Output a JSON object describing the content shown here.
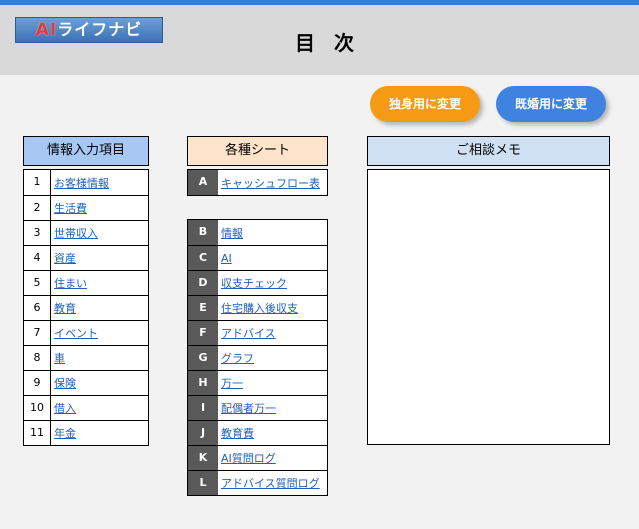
{
  "header": {
    "logo_ai": "AI",
    "logo_rest": "ライフナビ",
    "title": "目 次"
  },
  "buttons": {
    "single": "独身用に変更",
    "married": "既婚用に変更"
  },
  "columns": {
    "info": "情報入力項目",
    "sheets": "各種シート",
    "memo": "ご相談メモ"
  },
  "info_items": [
    {
      "num": "1",
      "label": "お客様情報"
    },
    {
      "num": "2",
      "label": "生活費"
    },
    {
      "num": "3",
      "label": "世帯収入"
    },
    {
      "num": "4",
      "label": "資産"
    },
    {
      "num": "5",
      "label": "住まい"
    },
    {
      "num": "6",
      "label": "教育"
    },
    {
      "num": "7",
      "label": "イベント"
    },
    {
      "num": "8",
      "label": "車"
    },
    {
      "num": "9",
      "label": "保険"
    },
    {
      "num": "10",
      "label": "借入"
    },
    {
      "num": "11",
      "label": "年金"
    }
  ],
  "sheet_a": [
    {
      "letter": "A",
      "label": "キャッシュフロー表"
    }
  ],
  "sheet_items": [
    {
      "letter": "B",
      "label": "情報"
    },
    {
      "letter": "C",
      "label": "AI"
    },
    {
      "letter": "D",
      "label": "収支チェック"
    },
    {
      "letter": "E",
      "label": "住宅購入後収支"
    },
    {
      "letter": "F",
      "label": "アドバイス"
    },
    {
      "letter": "G",
      "label": "グラフ"
    },
    {
      "letter": "H",
      "label": "万一"
    },
    {
      "letter": "I",
      "label": "配偶者万一"
    },
    {
      "letter": "J",
      "label": "教育費"
    },
    {
      "letter": "K",
      "label": "AI質問ログ"
    },
    {
      "letter": "L",
      "label": "アドバイス質問ログ"
    }
  ],
  "memo": {
    "text": ""
  }
}
